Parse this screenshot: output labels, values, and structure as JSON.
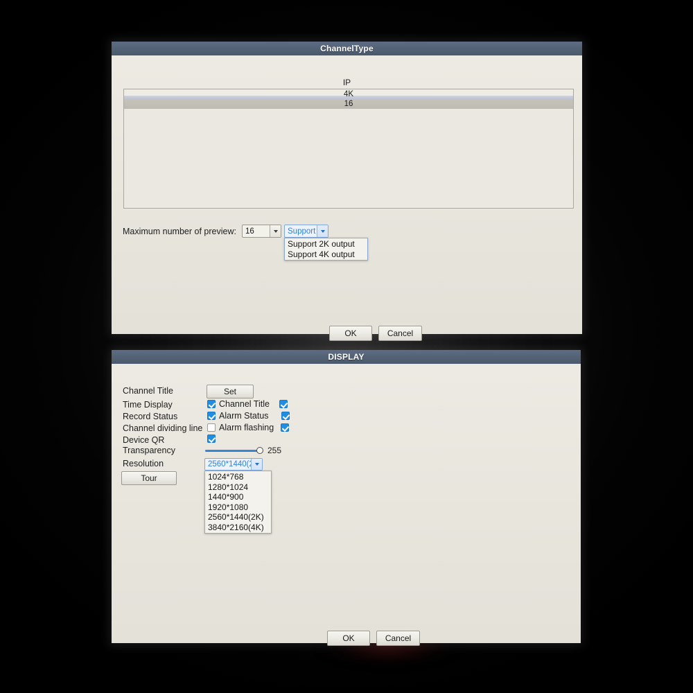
{
  "theme": {
    "desktop_background": "#000000",
    "dialog_background": "#e9e7df",
    "titlebar_color": "#4e5d75",
    "accent_blue": "#1f8ee4",
    "focus_text_blue": "#2f83d8",
    "selection_gray": "#c2bfb6"
  },
  "channel_type_dialog": {
    "title": "ChannelType",
    "list_header": "IP",
    "rows": [
      {
        "label": "4K",
        "state": "normal"
      },
      {
        "label": "16",
        "state": "selected"
      }
    ],
    "preview_label": "Maximum number of preview:",
    "preview_combo": {
      "value": "16",
      "options": [
        "16"
      ]
    },
    "support_combo": {
      "value": "Support",
      "options": [
        "Support 2K output",
        "Support 4K output"
      ],
      "expanded": true
    },
    "ok_label": "OK",
    "cancel_label": "Cancel"
  },
  "display_dialog": {
    "title": "DISPLAY",
    "channel_title_label": "Channel Title",
    "set_button_label": "Set",
    "rows": [
      {
        "label": "Time Display",
        "checked": true,
        "right_label": "Channel Title",
        "right_checked": true
      },
      {
        "label": "Record Status",
        "checked": true,
        "right_label": "Alarm Status",
        "right_checked": true
      },
      {
        "label": "Channel dividing line",
        "checked": false,
        "right_label": "Alarm flashing",
        "right_checked": true
      }
    ],
    "device_qr_label": "Device QR",
    "device_qr_checked": true,
    "transparency_label": "Transparency",
    "transparency_value": "255",
    "resolution_label": "Resolution",
    "resolution_combo": {
      "value": "2560*1440(2",
      "expanded": true,
      "options": [
        "1024*768",
        "1280*1024",
        "1440*900",
        "1920*1080",
        "2560*1440(2K)",
        "3840*2160(4K)"
      ]
    },
    "tour_button_label": "Tour",
    "ok_label": "OK",
    "cancel_label": "Cancel"
  }
}
